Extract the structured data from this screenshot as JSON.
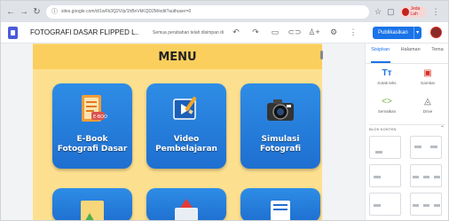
{
  "browser": {
    "url": "sites.google.com/d/1wFb3Q2V/p/1hBnVkKQD2M/edit?authuser=0",
    "profile_label": "Jeda Lah"
  },
  "toolbar": {
    "site_title": "FOTOGRAFI DASAR FLIPPED L...",
    "save_status": "Semua perubahan telah disimpan di Drive",
    "publish_label": "Publikasikan"
  },
  "page": {
    "menu_title": "MENU",
    "tiles": [
      {
        "label_1": "E-Book",
        "label_2": "Fotografi Dasar",
        "icon": "ebook-icon"
      },
      {
        "label_1": "Video",
        "label_2": "Pembelajaran",
        "icon": "video-icon"
      },
      {
        "label_1": "Simulasi",
        "label_2": "Fotografi",
        "icon": "camera-icon"
      }
    ]
  },
  "panel": {
    "tabs": [
      "Sisipkan",
      "Halaman",
      "Tema"
    ],
    "items": [
      {
        "label": "Kotak teks",
        "icon": "text-box-icon"
      },
      {
        "label": "Gambar",
        "icon": "image-icon"
      },
      {
        "label": "Sematkan",
        "icon": "embed-icon"
      },
      {
        "label": "Drive",
        "icon": "drive-icon"
      }
    ],
    "section_title": "BLOK KONTEN"
  },
  "colors": {
    "accent": "#1a73e8",
    "tile_blue": "#1f6fd0",
    "page_yellow": "#fde08f",
    "menu_band": "#fbcf5e"
  }
}
